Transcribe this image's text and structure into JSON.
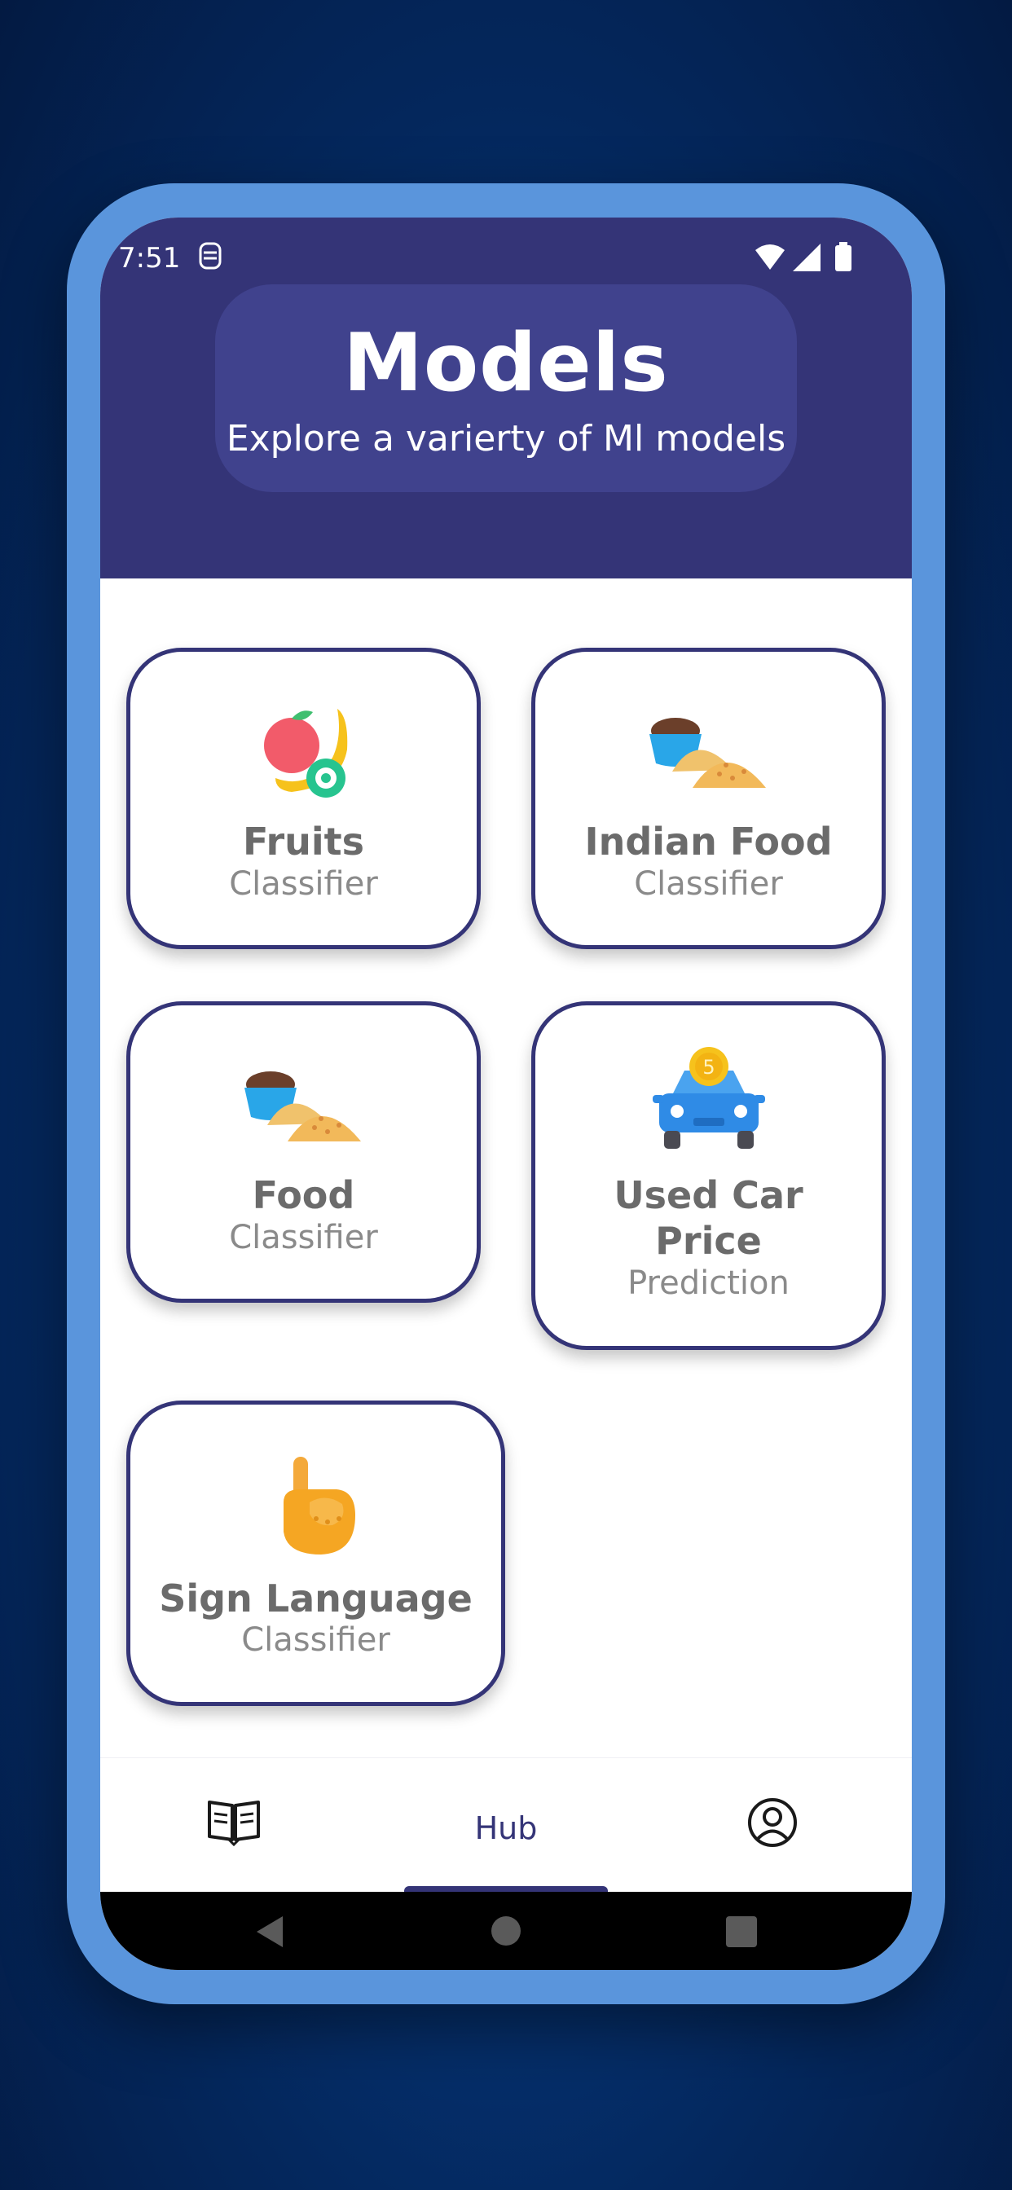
{
  "status_bar": {
    "time": "7:51"
  },
  "header": {
    "title": "Models",
    "subtitle": "Explore a varierty of Ml models"
  },
  "models": [
    {
      "name": "Fruits",
      "kind": "Classifier",
      "icon": "fruits-icon"
    },
    {
      "name": "Indian Food",
      "kind": "Classifier",
      "icon": "indian-food-icon"
    },
    {
      "name": "Food",
      "kind": "Classifier",
      "icon": "food-icon"
    },
    {
      "name_line1": "Used Car",
      "name_line2": "Price",
      "kind": "Prediction",
      "icon": "car-coin-icon"
    },
    {
      "name": "Sign Language",
      "kind": "Classifier",
      "icon": "sign-hand-icon"
    }
  ],
  "bottom_nav": {
    "left_icon": "book-icon",
    "center_label": "Hub",
    "right_icon": "profile-icon"
  },
  "colors": {
    "primary": "#343477",
    "title_card": "#40428d",
    "phone_frame": "#5a95dc",
    "background": "#063577"
  }
}
